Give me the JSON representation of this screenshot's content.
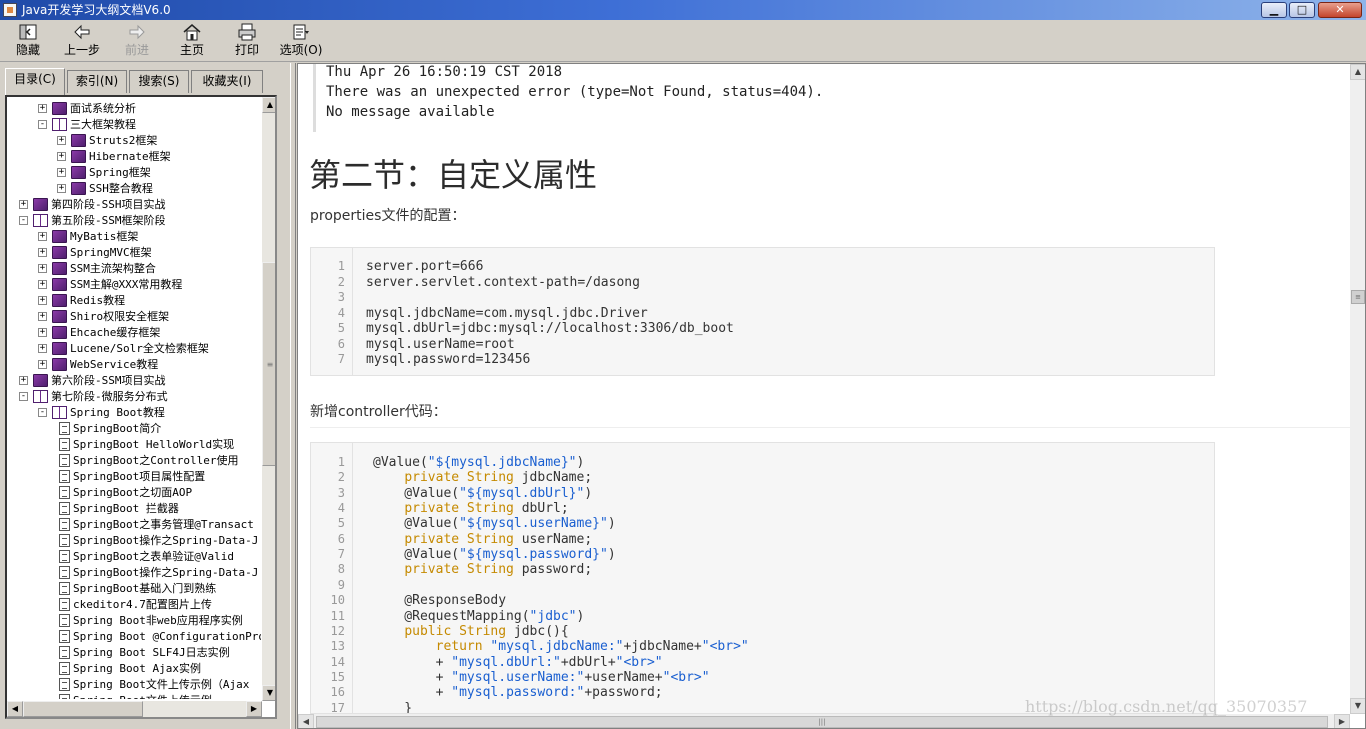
{
  "window": {
    "title": "Java开发学习大纲文档V6.0",
    "min_label": "▁",
    "max_label": "□",
    "close_label": "✕"
  },
  "toolbar": {
    "hide": "隐藏",
    "back": "上一步",
    "forward": "前进",
    "home": "主页",
    "print": "打印",
    "options": "选项(O)"
  },
  "tabs": {
    "contents": "目录(C)",
    "index": "索引(N)",
    "search": "搜索(S)",
    "favorites": "收藏夹(I)"
  },
  "tree": [
    {
      "level": 1,
      "icon": "closed",
      "expander": "+",
      "label": "面试系统分析"
    },
    {
      "level": 1,
      "icon": "open",
      "expander": "-",
      "label": "三大框架教程"
    },
    {
      "level": 2,
      "icon": "closed",
      "expander": "+",
      "label": "Struts2框架"
    },
    {
      "level": 2,
      "icon": "closed",
      "expander": "+",
      "label": "Hibernate框架"
    },
    {
      "level": 2,
      "icon": "closed",
      "expander": "+",
      "label": "Spring框架"
    },
    {
      "level": 2,
      "icon": "closed",
      "expander": "+",
      "label": "SSH整合教程"
    },
    {
      "level": 0,
      "icon": "closed",
      "expander": "+",
      "label": "第四阶段-SSH项目实战"
    },
    {
      "level": 0,
      "icon": "open",
      "expander": "-",
      "label": "第五阶段-SSM框架阶段"
    },
    {
      "level": 1,
      "icon": "closed",
      "expander": "+",
      "label": "MyBatis框架"
    },
    {
      "level": 1,
      "icon": "closed",
      "expander": "+",
      "label": "SpringMVC框架"
    },
    {
      "level": 1,
      "icon": "closed",
      "expander": "+",
      "label": "SSM主流架构整合"
    },
    {
      "level": 1,
      "icon": "closed",
      "expander": "+",
      "label": "SSM主解@XXX常用教程"
    },
    {
      "level": 1,
      "icon": "closed",
      "expander": "+",
      "label": "Redis教程"
    },
    {
      "level": 1,
      "icon": "closed",
      "expander": "+",
      "label": "Shiro权限安全框架"
    },
    {
      "level": 1,
      "icon": "closed",
      "expander": "+",
      "label": "Ehcache缓存框架"
    },
    {
      "level": 1,
      "icon": "closed",
      "expander": "+",
      "label": "Lucene/Solr全文检索框架"
    },
    {
      "level": 1,
      "icon": "closed",
      "expander": "+",
      "label": "WebService教程"
    },
    {
      "level": 0,
      "icon": "closed",
      "expander": "+",
      "label": "第六阶段-SSM项目实战"
    },
    {
      "level": 0,
      "icon": "open",
      "expander": "-",
      "label": "第七阶段-微服务分布式"
    },
    {
      "level": 1,
      "icon": "open",
      "expander": "-",
      "label": "Spring Boot教程"
    },
    {
      "level": 2,
      "icon": "page",
      "expander": "",
      "label": "SpringBoot简介"
    },
    {
      "level": 2,
      "icon": "page",
      "expander": "",
      "label": "SpringBoot HelloWorld实现"
    },
    {
      "level": 2,
      "icon": "page",
      "expander": "",
      "label": "SpringBoot之Controller使用"
    },
    {
      "level": 2,
      "icon": "page",
      "expander": "",
      "label": "SpringBoot项目属性配置"
    },
    {
      "level": 2,
      "icon": "page",
      "expander": "",
      "label": "SpringBoot之切面AOP"
    },
    {
      "level": 2,
      "icon": "page",
      "expander": "",
      "label": "SpringBoot 拦截器"
    },
    {
      "level": 2,
      "icon": "page",
      "expander": "",
      "label": "SpringBoot之事务管理@Transact"
    },
    {
      "level": 2,
      "icon": "page",
      "expander": "",
      "label": "SpringBoot操作之Spring-Data-J"
    },
    {
      "level": 2,
      "icon": "page",
      "expander": "",
      "label": "SpringBoot之表单验证@Valid"
    },
    {
      "level": 2,
      "icon": "page",
      "expander": "",
      "label": "SpringBoot操作之Spring-Data-J"
    },
    {
      "level": 2,
      "icon": "page",
      "expander": "",
      "label": "SpringBoot基础入门到熟练"
    },
    {
      "level": 2,
      "icon": "page",
      "expander": "",
      "label": "ckeditor4.7配置图片上传"
    },
    {
      "level": 2,
      "icon": "page",
      "expander": "",
      "label": "Spring Boot非web应用程序实例"
    },
    {
      "level": 2,
      "icon": "page",
      "expander": "",
      "label": "Spring Boot @ConfigurationPro"
    },
    {
      "level": 2,
      "icon": "page",
      "expander": "",
      "label": "Spring Boot SLF4J日志实例"
    },
    {
      "level": 2,
      "icon": "page",
      "expander": "",
      "label": "Spring Boot Ajax实例"
    },
    {
      "level": 2,
      "icon": "page",
      "expander": "",
      "label": "Spring Boot文件上传示例（Ajax"
    },
    {
      "level": 2,
      "icon": "page",
      "expander": "",
      "label": "Spring Boot文件上传示例"
    }
  ],
  "content": {
    "error_lines": [
      "Thu Apr 26 16:50:19 CST 2018",
      "There was an unexpected error (type=Not Found, status=404).",
      "No message available"
    ],
    "heading": "第二节：自定义属性",
    "para1": "properties文件的配置：",
    "para2": "新增controller代码：",
    "code1": [
      {
        "n": "1",
        "t": "server.port=666"
      },
      {
        "n": "2",
        "t": "server.servlet.context-path=/dasong"
      },
      {
        "n": "3",
        "t": ""
      },
      {
        "n": "4",
        "t": "mysql.jdbcName=com.mysql.jdbc.Driver"
      },
      {
        "n": "5",
        "t": "mysql.dbUrl=jdbc:mysql://localhost:3306/db_boot"
      },
      {
        "n": "6",
        "t": "mysql.userName=root"
      },
      {
        "n": "7",
        "t": "mysql.password=123456"
      }
    ],
    "code2": [
      {
        "n": "1",
        "parts": [
          [
            "plain",
            "@Value("
          ],
          [
            "str",
            "\"${mysql.jdbcName}\""
          ],
          [
            "plain",
            ")"
          ]
        ]
      },
      {
        "n": "2",
        "parts": [
          [
            "plain",
            "    "
          ],
          [
            "kw",
            "private String"
          ],
          [
            "plain",
            " jdbcName;"
          ]
        ]
      },
      {
        "n": "3",
        "parts": [
          [
            "plain",
            "    @Value("
          ],
          [
            "str",
            "\"${mysql.dbUrl}\""
          ],
          [
            "plain",
            ")"
          ]
        ]
      },
      {
        "n": "4",
        "parts": [
          [
            "plain",
            "    "
          ],
          [
            "kw",
            "private String"
          ],
          [
            "plain",
            " dbUrl;"
          ]
        ]
      },
      {
        "n": "5",
        "parts": [
          [
            "plain",
            "    @Value("
          ],
          [
            "str",
            "\"${mysql.userName}\""
          ],
          [
            "plain",
            ")"
          ]
        ]
      },
      {
        "n": "6",
        "parts": [
          [
            "plain",
            "    "
          ],
          [
            "kw",
            "private String"
          ],
          [
            "plain",
            " userName;"
          ]
        ]
      },
      {
        "n": "7",
        "parts": [
          [
            "plain",
            "    @Value("
          ],
          [
            "str",
            "\"${mysql.password}\""
          ],
          [
            "plain",
            ")"
          ]
        ]
      },
      {
        "n": "8",
        "parts": [
          [
            "plain",
            "    "
          ],
          [
            "kw",
            "private String"
          ],
          [
            "plain",
            " password;"
          ]
        ]
      },
      {
        "n": "9",
        "parts": [
          [
            "plain",
            ""
          ]
        ]
      },
      {
        "n": "10",
        "parts": [
          [
            "plain",
            "    @ResponseBody"
          ]
        ]
      },
      {
        "n": "11",
        "parts": [
          [
            "plain",
            "    @RequestMapping("
          ],
          [
            "str",
            "\"jdbc\""
          ],
          [
            "plain",
            ")"
          ]
        ]
      },
      {
        "n": "12",
        "parts": [
          [
            "plain",
            "    "
          ],
          [
            "kw",
            "public String"
          ],
          [
            "plain",
            " jdbc(){"
          ]
        ]
      },
      {
        "n": "13",
        "parts": [
          [
            "plain",
            "        "
          ],
          [
            "kw",
            "return"
          ],
          [
            "plain",
            " "
          ],
          [
            "str",
            "\"mysql.jdbcName:\""
          ],
          [
            "plain",
            "+jdbcName+"
          ],
          [
            "str",
            "\"<br>\""
          ]
        ]
      },
      {
        "n": "14",
        "parts": [
          [
            "plain",
            "        + "
          ],
          [
            "str",
            "\"mysql.dbUrl:\""
          ],
          [
            "plain",
            "+dbUrl+"
          ],
          [
            "str",
            "\"<br>\""
          ]
        ]
      },
      {
        "n": "15",
        "parts": [
          [
            "plain",
            "        + "
          ],
          [
            "str",
            "\"mysql.userName:\""
          ],
          [
            "plain",
            "+userName+"
          ],
          [
            "str",
            "\"<br>\""
          ]
        ]
      },
      {
        "n": "16",
        "parts": [
          [
            "plain",
            "        + "
          ],
          [
            "str",
            "\"mysql.password:\""
          ],
          [
            "plain",
            "+password;"
          ]
        ]
      },
      {
        "n": "17",
        "parts": [
          [
            "plain",
            "    }"
          ]
        ]
      }
    ]
  },
  "watermark": "https://blog.csdn.net/qq_35070357"
}
